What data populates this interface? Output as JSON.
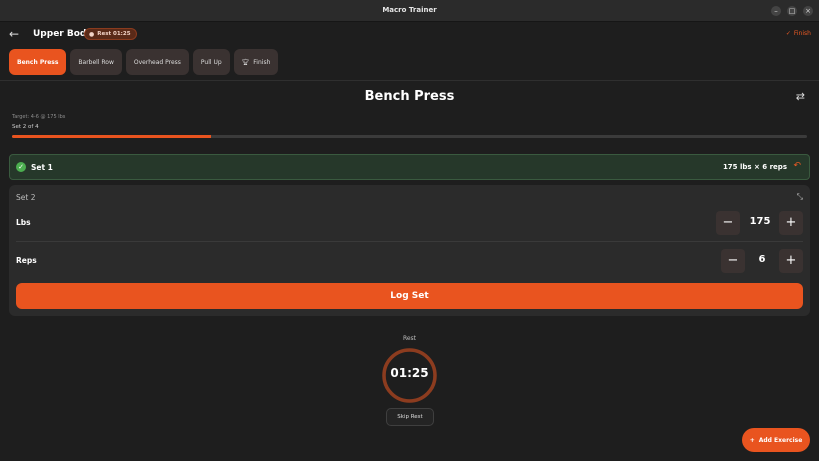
{
  "window": {
    "title": "Macro Trainer"
  },
  "header": {
    "workout_title": "Upper Body",
    "rest_badge": "Rest 01:25",
    "finish_label": "Finish"
  },
  "tabs": [
    {
      "label": "Bench Press",
      "active": true
    },
    {
      "label": "Barbell Row",
      "active": false
    },
    {
      "label": "Overhead Press",
      "active": false
    },
    {
      "label": "Pull Up",
      "active": false
    },
    {
      "label": "Finish",
      "active": false,
      "icon": "trophy-icon"
    }
  ],
  "exercise": {
    "title": "Bench Press",
    "target": "Target: 4-6 @ 175 lbs",
    "set_progress": "Set 2 of 4",
    "progress_fraction": 0.25
  },
  "completed_set": {
    "label": "Set 1",
    "summary": "175 lbs × 6 reps"
  },
  "current_set": {
    "title": "Set 2",
    "lbs_label": "Lbs",
    "lbs_value": "175",
    "reps_label": "Reps",
    "reps_value": "6",
    "log_label": "Log Set"
  },
  "rest_timer": {
    "label": "Rest",
    "time": "01:25",
    "skip_label": "Skip Rest"
  },
  "fab": {
    "label": "Add Exercise"
  },
  "colors": {
    "accent": "#e9541f",
    "success": "#4caf50",
    "background": "#1e1e1e",
    "card": "#2b2b2b"
  }
}
